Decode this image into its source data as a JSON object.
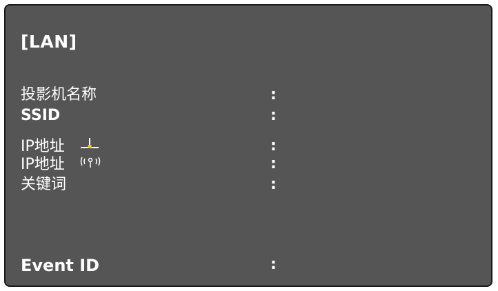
{
  "panel": {
    "title": "[LAN]",
    "colon": ":",
    "rows": [
      {
        "label": "投影机名称",
        "icon": null
      },
      {
        "label": "SSID",
        "icon": null
      },
      {
        "label": "IP地址",
        "icon": "wired-lan-icon"
      },
      {
        "label": "IP地址",
        "icon": "wireless-lan-icon"
      },
      {
        "label": "关键词",
        "icon": null
      },
      {
        "label": "Event ID",
        "icon": null
      }
    ]
  },
  "colors": {
    "panel_background": "#555555",
    "panel_border": "#1a1a1a",
    "text": "#ffffff",
    "wired_icon_accent": "#f5c518"
  }
}
